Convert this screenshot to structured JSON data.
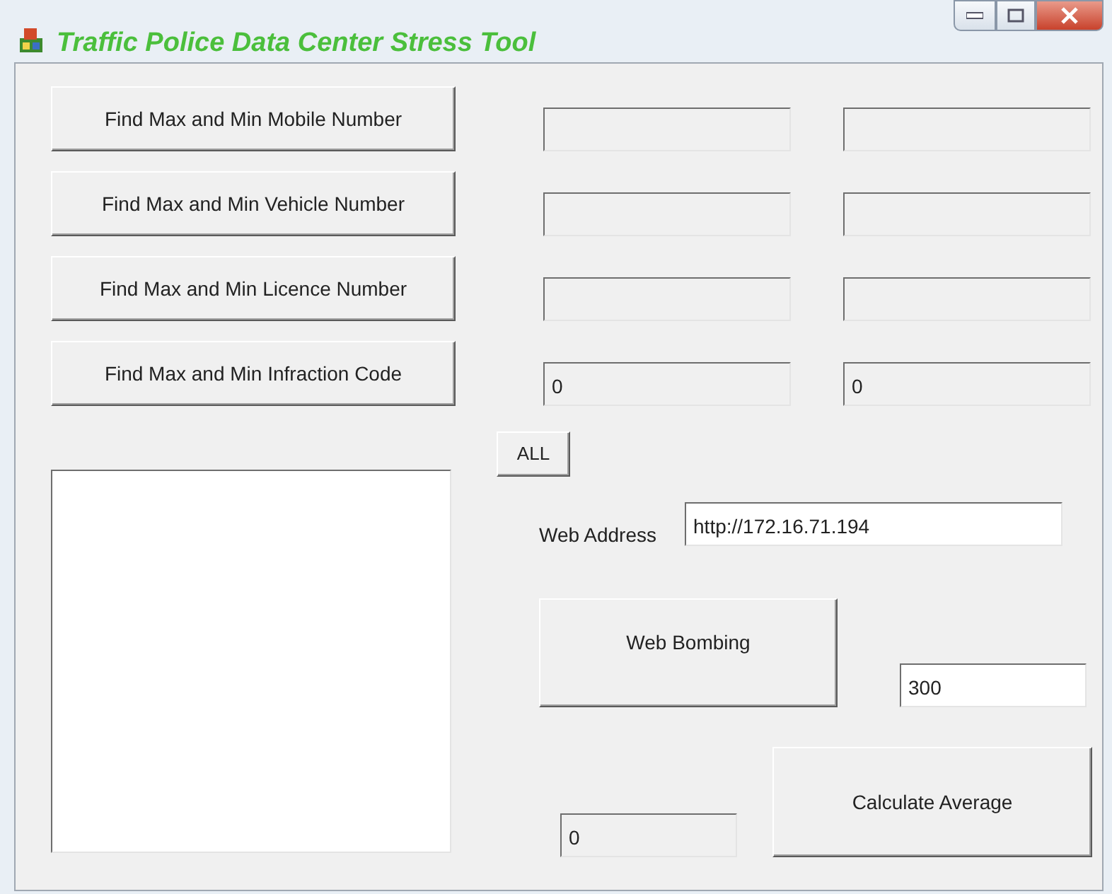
{
  "window": {
    "title": "Traffic Police Data Center Stress Tool"
  },
  "find_rows": [
    {
      "button": "Find Max and Min Mobile Number"
    },
    {
      "button": "Find Max and Min Vehicle Number"
    },
    {
      "button": "Find Max and Min Licence Number"
    },
    {
      "button": "Find Max and Min Infraction Code",
      "values": [
        "0",
        "0"
      ]
    }
  ],
  "all_button": "ALL",
  "web_address": {
    "label": "Web Address",
    "value": "http://172.16.71.194"
  },
  "web_bombing_button": "Web Bombing",
  "request_count": "300",
  "average_output": "0",
  "calculate_button": "Calculate Average"
}
